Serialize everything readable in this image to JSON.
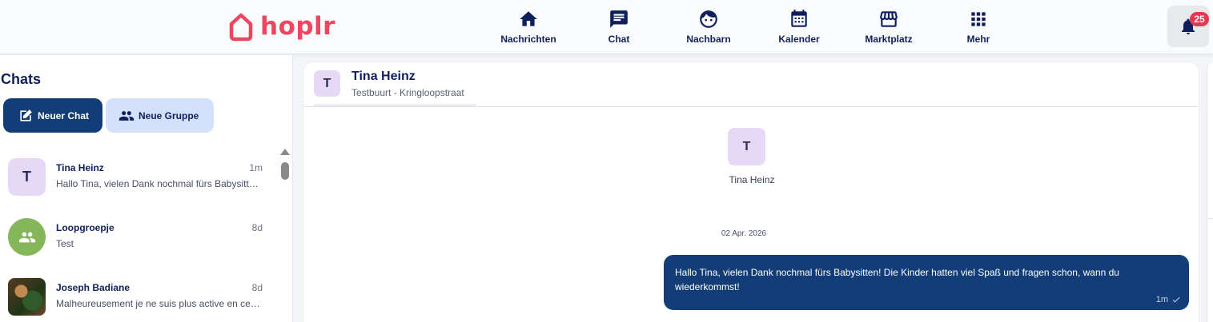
{
  "app": {
    "logo_text": "hoplr",
    "brand_color": "#ef4660",
    "accent_color": "#123d76"
  },
  "nav": {
    "items": [
      {
        "label": "Nachrichten",
        "icon": "home-icon"
      },
      {
        "label": "Chat",
        "icon": "chat-icon"
      },
      {
        "label": "Nachbarn",
        "icon": "face-icon"
      },
      {
        "label": "Kalender",
        "icon": "calendar-icon"
      },
      {
        "label": "Marktplatz",
        "icon": "storefront-icon"
      },
      {
        "label": "Mehr",
        "icon": "apps-grid-icon"
      }
    ],
    "notifications": {
      "icon": "bell-icon",
      "count": "25"
    }
  },
  "sidebar": {
    "title": "Chats",
    "new_chat_label": "Neuer Chat",
    "new_group_label": "Neue Gruppe",
    "chats": [
      {
        "name": "Tina Heinz",
        "time": "1m",
        "preview": "Hallo Tina, vielen Dank nochmal fürs Babysitten! Die Kinder hatten viel Spaß und fragen schon, wann du wiederkommst!",
        "avatar_letter": "T"
      },
      {
        "name": "Loopgroepje",
        "time": "8d",
        "preview": "Test",
        "avatar_icon": "group-icon"
      },
      {
        "name": "Joseph Badiane",
        "time": "8d",
        "preview": "Malheureusement je ne suis plus active en ce moment",
        "avatar_icon": "profile-photo"
      }
    ]
  },
  "conversation": {
    "header_letter": "T",
    "header_name": "Tina Heinz",
    "header_subtitle": "Testbuurt - Kringloopstraat",
    "intro_letter": "T",
    "intro_name": "Tina Heinz",
    "date_separator": "02 Apr. 2026",
    "messages": [
      {
        "text": "Hallo Tina, vielen Dank nochmal fürs Babysitten! Die Kinder hatten viel Spaß und fragen schon, wann du wiederkommst!",
        "time": "1m",
        "status_icon": "check-icon"
      }
    ]
  }
}
